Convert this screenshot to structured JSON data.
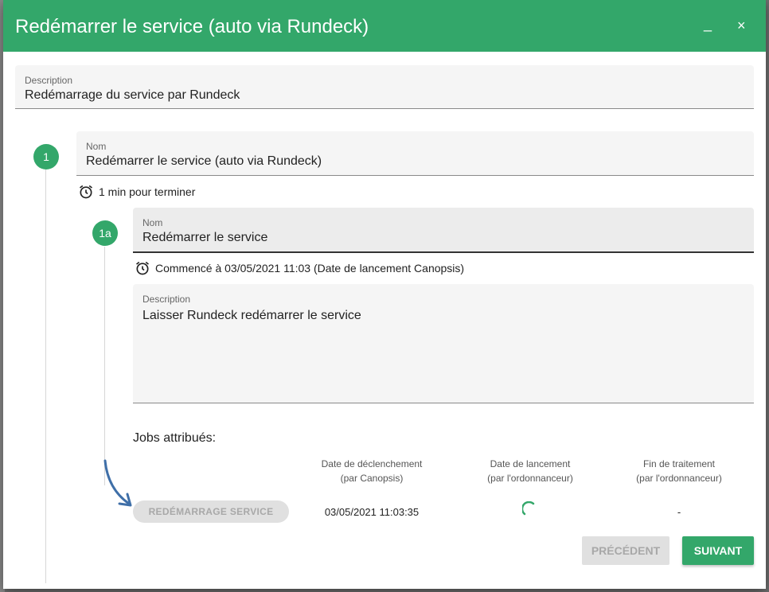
{
  "dialog": {
    "title": "Redémarrer le service (auto via Rundeck)",
    "minimize_label": "_",
    "close_label": "×"
  },
  "description_field": {
    "label": "Description",
    "value": "Redémarrage du service par Rundeck"
  },
  "step1": {
    "number": "1",
    "name_label": "Nom",
    "name_value": "Redémarrer le service (auto via Rundeck)",
    "duration": "1 min pour terminer"
  },
  "step1a": {
    "number": "1a",
    "name_label": "Nom",
    "name_value": "Redémarrer le service",
    "started": "Commencé à 03/05/2021 11:03 (Date de lancement Canopsis)",
    "description_label": "Description",
    "description_value": "Laisser Rundeck redémarrer le service"
  },
  "jobs": {
    "title": "Jobs attribués:",
    "headers": [
      {
        "line1": "Date de déclenchement",
        "line2": "(par Canopsis)"
      },
      {
        "line1": "Date de lancement",
        "line2": "(par l'ordonnanceur)"
      },
      {
        "line1": "Fin de traitement",
        "line2": "(par l'ordonnanceur)"
      }
    ],
    "rows": [
      {
        "job": "REDÉMARRAGE SERVICE",
        "trigger_date": "03/05/2021 11:03:35",
        "end": "-"
      }
    ]
  },
  "footer": {
    "previous_label": "PRÉCÉDENT",
    "next_label": "SUIVANT"
  },
  "colors": {
    "accent": "#33a76a",
    "arrow": "#3f6fa8"
  },
  "icons": [
    "alarm-clock-icon",
    "loading-spinner-icon",
    "arrow-annotation"
  ]
}
